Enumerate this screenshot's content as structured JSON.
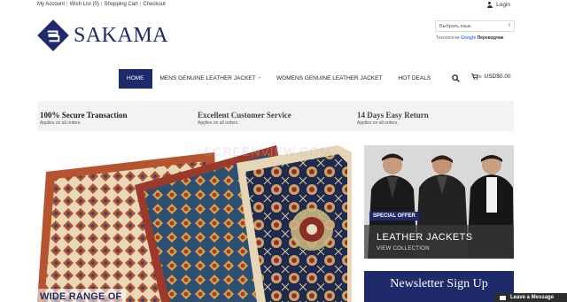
{
  "topbar": {
    "links": [
      "My Account",
      "Wish List (0)",
      "Shopping Cart",
      "Checkout"
    ],
    "login": "Login"
  },
  "brand": {
    "name": "SAKAMA",
    "color": "#1f2a6b"
  },
  "language": {
    "select_label": "Выбрать язык",
    "powered_prefix": "Технологии",
    "powered_google": "Google",
    "powered_suffix": "Переводчик"
  },
  "nav": {
    "items": [
      {
        "label": "HOME",
        "active": true
      },
      {
        "label": "MENS GENUINE LEATHER JACKET",
        "dropdown": true
      },
      {
        "label": "WOMENS GENUINE LEATHER JACKET"
      },
      {
        "label": "HOT DEALS"
      }
    ],
    "cart_count": "0",
    "cart_total": "USD$0.00"
  },
  "features": [
    {
      "title": "100% Secure Transaction",
      "sub": "Applies on all orders."
    },
    {
      "title": "Excellent Customer Service",
      "sub": "Applies on all orders."
    },
    {
      "title": "14 Days Easy Return",
      "sub": "Applies on all orders."
    }
  ],
  "hero": {
    "caption": "WIDE RANGE OF",
    "watermark": "SCREENVIEW.COM"
  },
  "promo": {
    "badge": "SPECIAL OFFER",
    "title": "LEATHER JACKETS",
    "link": "VIEW COLLECTION"
  },
  "newsletter": {
    "title": "Newsletter Sign Up"
  },
  "chat": {
    "label": "Leave a Message"
  },
  "icons": [
    "user-icon",
    "search-icon",
    "cart-icon",
    "chat-icon",
    "dropdown-arrow-icon"
  ]
}
